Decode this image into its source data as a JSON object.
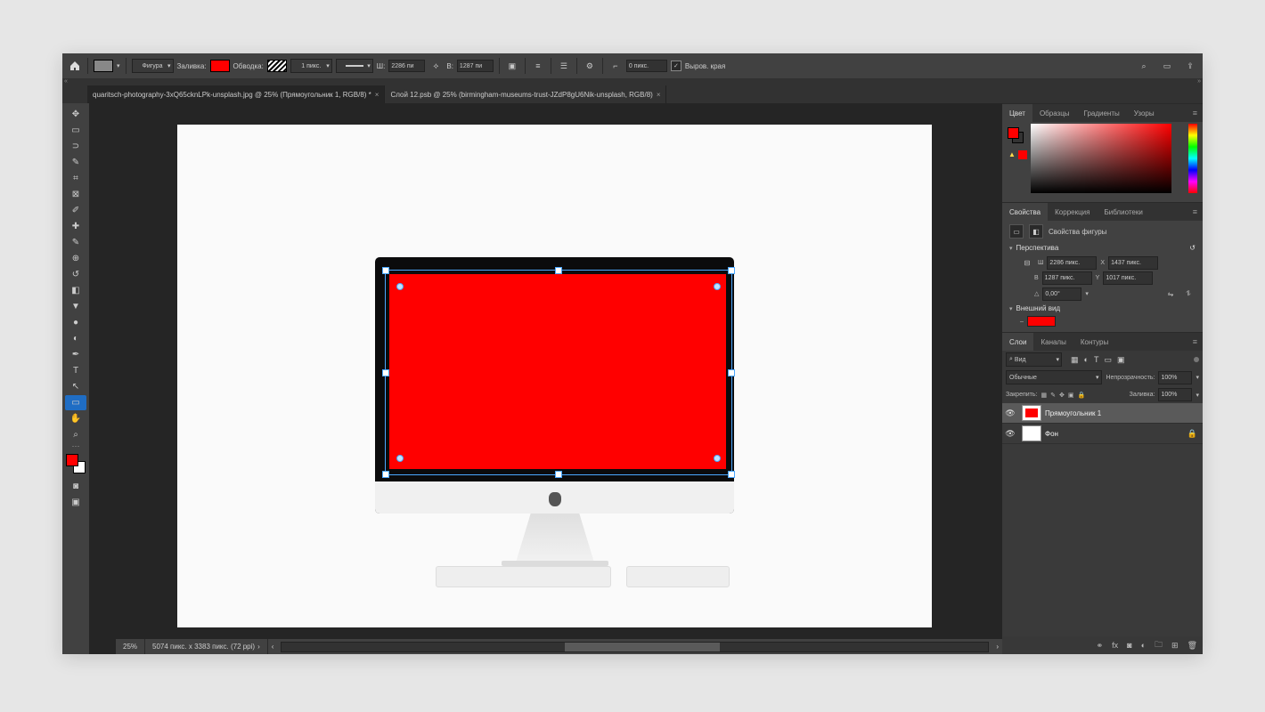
{
  "colors": {
    "accent": "#ff0000",
    "select": "#1f6dc4",
    "handle": "#4aa7ff"
  },
  "optbar": {
    "shape_mode": "Фигура",
    "fill_label": "Заливка:",
    "stroke_label": "Обводка:",
    "stroke_size": "1 пикс.",
    "w_label": "Ш:",
    "w_val": "2286 пи",
    "h_label": "В:",
    "h_val": "1287 пи",
    "radius": "0 пикс.",
    "align_edges": "Выров. края"
  },
  "tabs": [
    {
      "title": "quaritsch-photography-3xQ65cknLPk-unsplash.jpg @ 25% (Прямоугольник 1, RGB/8) *",
      "active": true
    },
    {
      "title": "Слой 12.psb @ 25% (birmingham-museums-trust-JZdP8gU6Nik-unsplash, RGB/8)",
      "active": false
    }
  ],
  "panels": {
    "color": {
      "tabs": [
        "Цвет",
        "Образцы",
        "Градиенты",
        "Узоры"
      ]
    },
    "props": {
      "tabs": [
        "Свойства",
        "Коррекция",
        "Библиотеки"
      ],
      "header": "Свойства фигуры",
      "transform": "Перспектива",
      "w_lbl": "Ш",
      "w": "2286 пикс.",
      "x_lbl": "X",
      "x": "1437 пикс.",
      "h_lbl": "В",
      "h": "1287 пикс.",
      "y_lbl": "Y",
      "y": "1017 пикс.",
      "angle": "0,00°",
      "appearance": "Внешний вид"
    },
    "layers": {
      "tabs": [
        "Слои",
        "Каналы",
        "Контуры"
      ],
      "kind": "Вид",
      "blend": "Обычные",
      "opacity_lbl": "Непрозрачность:",
      "opacity": "100%",
      "lock_lbl": "Закрепить:",
      "fill_lbl": "Заливка:",
      "fill": "100%",
      "items": [
        {
          "name": "Прямоугольник 1",
          "selected": true,
          "visible": true,
          "thumb": "red"
        },
        {
          "name": "Фон",
          "selected": false,
          "visible": true,
          "locked": true,
          "thumb": "white"
        }
      ]
    }
  },
  "status": {
    "zoom": "25%",
    "dims": "5074 пикс. x 3383 пикс. (72 ppi)"
  }
}
